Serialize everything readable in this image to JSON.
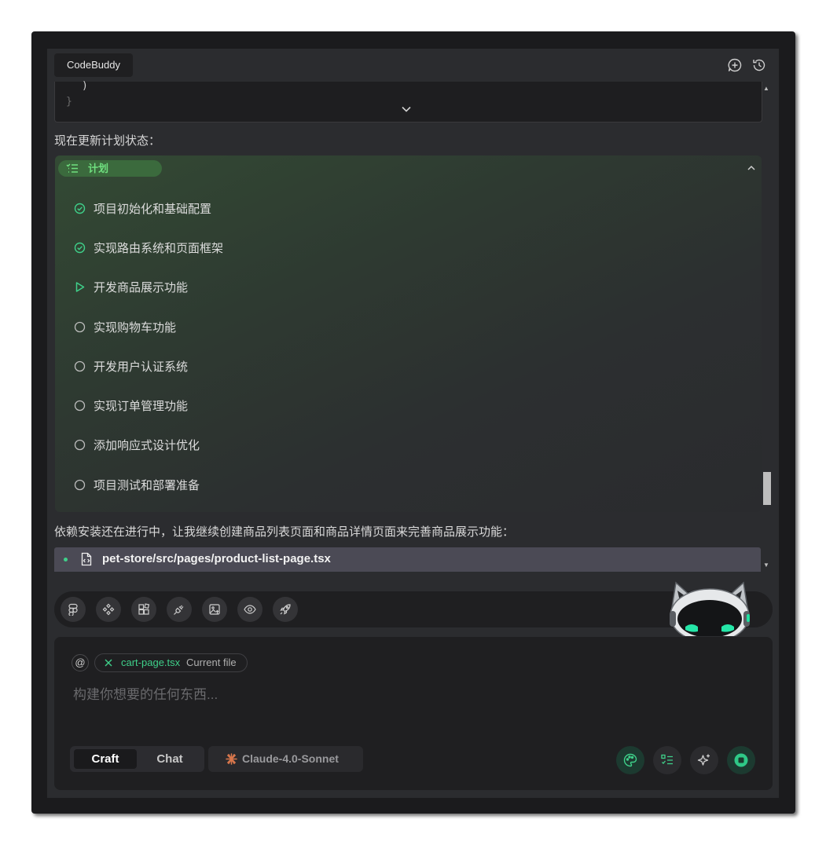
{
  "header": {
    "tab_label": "CodeBuddy",
    "new_chat_icon": "add-chat-icon",
    "history_icon": "history-icon"
  },
  "code_snippet": {
    "line1": ")",
    "line2": "}"
  },
  "messages": {
    "update_plan": "现在更新计划状态：",
    "continue": "依赖安装还在进行中，让我继续创建商品列表页面和商品详情页面来完善商品展示功能："
  },
  "plan": {
    "title": "计划",
    "items": [
      {
        "label": "项目初始化和基础配置",
        "status": "done"
      },
      {
        "label": "实现路由系统和页面框架",
        "status": "done"
      },
      {
        "label": "开发商品展示功能",
        "status": "in-progress"
      },
      {
        "label": "实现购物车功能",
        "status": "pending"
      },
      {
        "label": "开发用户认证系统",
        "status": "pending"
      },
      {
        "label": "实现订单管理功能",
        "status": "pending"
      },
      {
        "label": "添加响应式设计优化",
        "status": "pending"
      },
      {
        "label": "项目测试和部署准备",
        "status": "pending"
      }
    ]
  },
  "file_edit": {
    "path": "pet-store/src/pages/product-list-page.tsx"
  },
  "toolbar": {
    "tools": [
      "figma-icon",
      "components-icon",
      "blocks-icon",
      "plug-icon",
      "image-upload-icon",
      "preview-icon",
      "deploy-rocket-icon"
    ]
  },
  "input": {
    "at_symbol": "@",
    "context_file": "cart-page.tsx",
    "context_file_sub": "Current file",
    "placeholder": "构建你想要的任何东西..."
  },
  "modes": {
    "craft": "Craft",
    "chat": "Chat",
    "active": "Craft"
  },
  "model": {
    "name": "Claude-4.0-Sonnet"
  },
  "colors": {
    "accent_green": "#3fd08a",
    "plan_green": "#6fe07f",
    "panel_bg": "#2b2c2f"
  }
}
